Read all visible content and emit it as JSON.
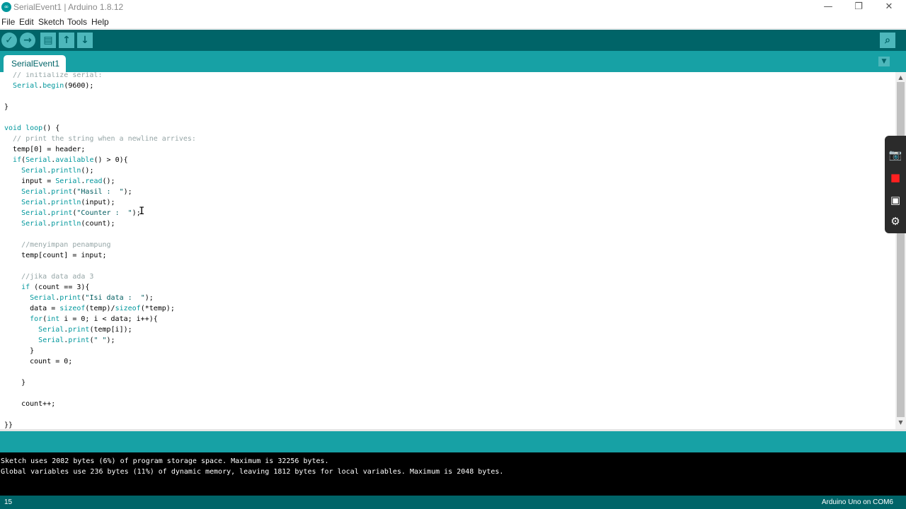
{
  "window": {
    "title": "SerialEvent1 | Arduino 1.8.12",
    "logo_glyph": "∞",
    "controls": {
      "minimize": "—",
      "maximize": "❐",
      "close": "✕"
    }
  },
  "menu": [
    "File",
    "Edit",
    "Sketch",
    "Tools",
    "Help"
  ],
  "toolbar": {
    "verify_icon": "✓",
    "upload_icon": "→",
    "new_icon": "▤",
    "open_icon": "↑",
    "save_icon": "↓",
    "serial_monitor_icon": "⌕"
  },
  "tabs": [
    {
      "label": "SerialEvent1",
      "active": true
    }
  ],
  "tab_menu_icon": "▼",
  "editor": {
    "lines": [
      [
        {
          "t": "  // initialize serial:",
          "c": "cm"
        }
      ],
      [
        {
          "t": "  "
        },
        {
          "t": "Serial",
          "c": "kw"
        },
        {
          "t": ".",
          "c": ""
        },
        {
          "t": "begin",
          "c": "kw"
        },
        {
          "t": "(9600);"
        }
      ],
      [
        {
          "t": ""
        }
      ],
      [
        {
          "t": "}"
        }
      ],
      [
        {
          "t": ""
        }
      ],
      [
        {
          "t": "void",
          "c": "kw"
        },
        {
          "t": " "
        },
        {
          "t": "loop",
          "c": "kw"
        },
        {
          "t": "() {"
        }
      ],
      [
        {
          "t": "  // print the string when a newline arrives:",
          "c": "cm"
        }
      ],
      [
        {
          "t": "  temp[0] = header;"
        }
      ],
      [
        {
          "t": "  "
        },
        {
          "t": "if",
          "c": "kw"
        },
        {
          "t": "("
        },
        {
          "t": "Serial",
          "c": "kw"
        },
        {
          "t": "."
        },
        {
          "t": "available",
          "c": "kw"
        },
        {
          "t": "() > 0){"
        }
      ],
      [
        {
          "t": "    "
        },
        {
          "t": "Serial",
          "c": "kw"
        },
        {
          "t": "."
        },
        {
          "t": "println",
          "c": "kw"
        },
        {
          "t": "();"
        }
      ],
      [
        {
          "t": "    input = "
        },
        {
          "t": "Serial",
          "c": "kw"
        },
        {
          "t": "."
        },
        {
          "t": "read",
          "c": "kw"
        },
        {
          "t": "();"
        }
      ],
      [
        {
          "t": "    "
        },
        {
          "t": "Serial",
          "c": "kw"
        },
        {
          "t": "."
        },
        {
          "t": "print",
          "c": "kw"
        },
        {
          "t": "("
        },
        {
          "t": "\"Hasil :  \"",
          "c": "str"
        },
        {
          "t": ");"
        }
      ],
      [
        {
          "t": "    "
        },
        {
          "t": "Serial",
          "c": "kw"
        },
        {
          "t": "."
        },
        {
          "t": "println",
          "c": "kw"
        },
        {
          "t": "(input);"
        }
      ],
      [
        {
          "t": "    "
        },
        {
          "t": "Serial",
          "c": "kw"
        },
        {
          "t": "."
        },
        {
          "t": "print",
          "c": "kw"
        },
        {
          "t": "("
        },
        {
          "t": "\"Counter :  \"",
          "c": "str"
        },
        {
          "t": ");"
        }
      ],
      [
        {
          "t": "    "
        },
        {
          "t": "Serial",
          "c": "kw"
        },
        {
          "t": "."
        },
        {
          "t": "println",
          "c": "kw"
        },
        {
          "t": "(count);"
        }
      ],
      [
        {
          "t": ""
        }
      ],
      [
        {
          "t": "    //menyimpan penampung",
          "c": "cm"
        }
      ],
      [
        {
          "t": "    temp[count] = input;"
        }
      ],
      [
        {
          "t": ""
        }
      ],
      [
        {
          "t": "    //jika data ada 3",
          "c": "cm"
        }
      ],
      [
        {
          "t": "    "
        },
        {
          "t": "if",
          "c": "kw"
        },
        {
          "t": " (count == 3){"
        }
      ],
      [
        {
          "t": "      "
        },
        {
          "t": "Serial",
          "c": "kw"
        },
        {
          "t": "."
        },
        {
          "t": "print",
          "c": "kw"
        },
        {
          "t": "("
        },
        {
          "t": "\"Isi data :  \"",
          "c": "str"
        },
        {
          "t": ");"
        }
      ],
      [
        {
          "t": "      data = "
        },
        {
          "t": "sizeof",
          "c": "kw"
        },
        {
          "t": "(temp)/"
        },
        {
          "t": "sizeof",
          "c": "kw"
        },
        {
          "t": "(*temp);"
        }
      ],
      [
        {
          "t": "      "
        },
        {
          "t": "for",
          "c": "kw"
        },
        {
          "t": "("
        },
        {
          "t": "int",
          "c": "kw"
        },
        {
          "t": " i = 0; i < data; i++){"
        }
      ],
      [
        {
          "t": "        "
        },
        {
          "t": "Serial",
          "c": "kw"
        },
        {
          "t": "."
        },
        {
          "t": "print",
          "c": "kw"
        },
        {
          "t": "(temp[i]);"
        }
      ],
      [
        {
          "t": "        "
        },
        {
          "t": "Serial",
          "c": "kw"
        },
        {
          "t": "."
        },
        {
          "t": "print",
          "c": "kw"
        },
        {
          "t": "("
        },
        {
          "t": "\" \"",
          "c": "str"
        },
        {
          "t": ");"
        }
      ],
      [
        {
          "t": "      }"
        }
      ],
      [
        {
          "t": "      count = 0;"
        }
      ],
      [
        {
          "t": ""
        }
      ],
      [
        {
          "t": "    }"
        }
      ],
      [
        {
          "t": ""
        }
      ],
      [
        {
          "t": "    count++;"
        }
      ],
      [
        {
          "t": ""
        }
      ],
      [
        {
          "t": "}}"
        }
      ]
    ]
  },
  "scrollbar": {
    "up_icon": "▲",
    "down_icon": "▼"
  },
  "capture_widget": [
    "camera-icon",
    "record-icon",
    "gallery-icon",
    "settings-icon"
  ],
  "capture_widget_glyphs": [
    "📷",
    "■",
    "▣",
    "⚙"
  ],
  "console": {
    "lines": [
      "Sketch uses 2082 bytes (6%) of program storage space. Maximum is 32256 bytes.",
      "Global variables use 236 bytes (11%) of dynamic memory, leaving 1812 bytes for local variables. Maximum is 2048 bytes."
    ]
  },
  "footer": {
    "line_number": "15",
    "board": "Arduino Uno on COM6"
  },
  "colors": {
    "toolbar": "#006468",
    "tabbar": "#17a1a5",
    "keyword": "#00979c",
    "comment": "#95a5a6",
    "console_bg": "#000000"
  }
}
